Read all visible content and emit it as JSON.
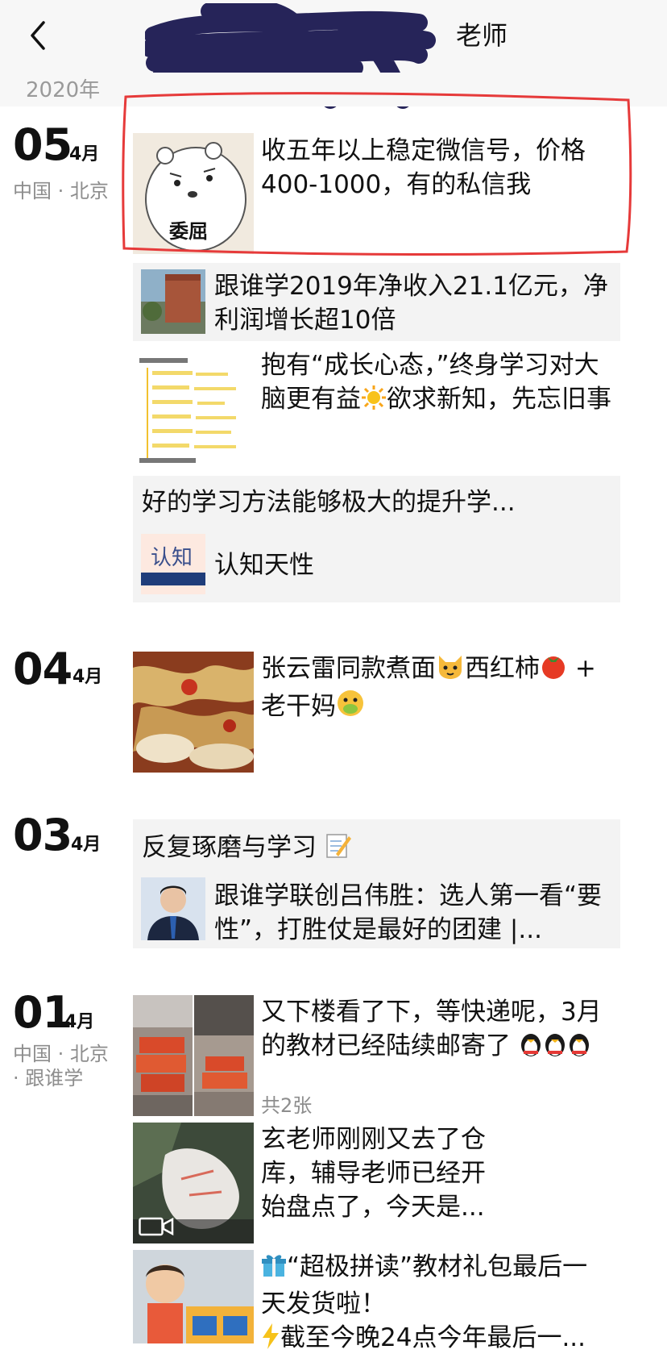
{
  "nav": {
    "title_visible": "老师"
  },
  "year": "2020年",
  "entries": [
    {
      "day": "05",
      "month": "4月",
      "location": "中国 · 北京",
      "posts": [
        {
          "text": "收五年以上稳定微信号，价格400-1000，有的私信我",
          "sticker_label": "委屈"
        },
        {
          "text": "跟谁学2019年净收入21.1亿元，净利润增长超10倍"
        },
        {
          "text_before": "抱有“成长心态，”终身学习对大脑更有益",
          "text_after": "欲求新知，先忘旧事"
        },
        {
          "headline": "好的学习方法能够极大的提升学...",
          "link_title": "认知天性",
          "thumb_text": "认知"
        }
      ]
    },
    {
      "day": "04",
      "month": "4月",
      "posts": [
        {
          "text_a": "张云雷同款煮面",
          "text_b": "西红柿",
          "text_c": " +",
          "text_d": "老干妈"
        }
      ]
    },
    {
      "day": "03",
      "month": "4月",
      "posts": [
        {
          "headline": "反复琢磨与学习",
          "link_title": "跟谁学联创吕伟胜：选人第一看“要性”，打胜仗是最好的团建 |..."
        }
      ]
    },
    {
      "day": "01",
      "month": "4月",
      "location_line1": "中国 · 北京",
      "location_line2": "· 跟谁学",
      "posts": [
        {
          "text": "又下楼看了下，等快递呢，3月的教材已经陆续邮寄了",
          "count": "共2张"
        },
        {
          "text": "玄老师刚刚又去了仓库，辅导老师已经开始盘点了，今天是..."
        },
        {
          "line1": "“超极拼读”教材礼包最后一",
          "line2": "天发货啦！",
          "line3": "截至今晚24点今年最后一..."
        }
      ]
    }
  ]
}
